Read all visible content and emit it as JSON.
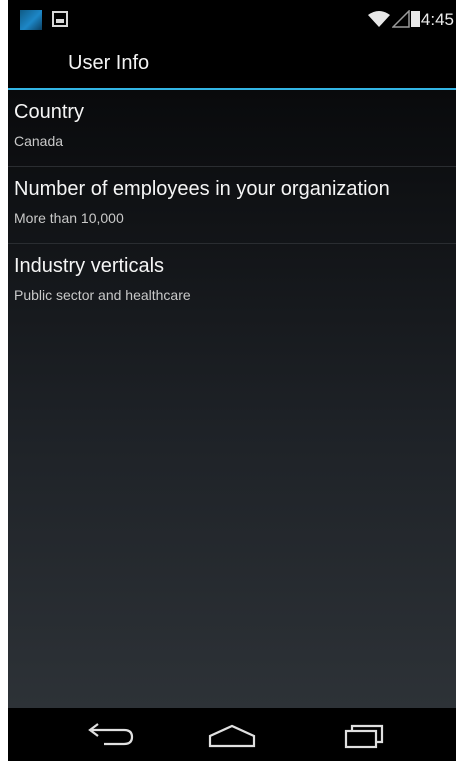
{
  "status_bar": {
    "time": "4:45",
    "icons": [
      "app-thumbnail-icon",
      "image-notification-icon",
      "wifi-icon",
      "signal-icon",
      "battery-icon"
    ]
  },
  "action_bar": {
    "title": "User Info"
  },
  "preferences": [
    {
      "title": "Country",
      "summary": "Canada"
    },
    {
      "title": "Number of employees in your organization",
      "summary": "More than 10,000"
    },
    {
      "title": "Industry verticals",
      "summary": "Public sector and healthcare"
    }
  ],
  "navigation_bar": {
    "buttons": [
      "back-icon",
      "home-icon",
      "recent-apps-icon"
    ]
  },
  "colors": {
    "accent": "#33b5e5",
    "background": "#000000",
    "title_text": "#f5f5f5",
    "summary_text": "#c9c9c9"
  }
}
